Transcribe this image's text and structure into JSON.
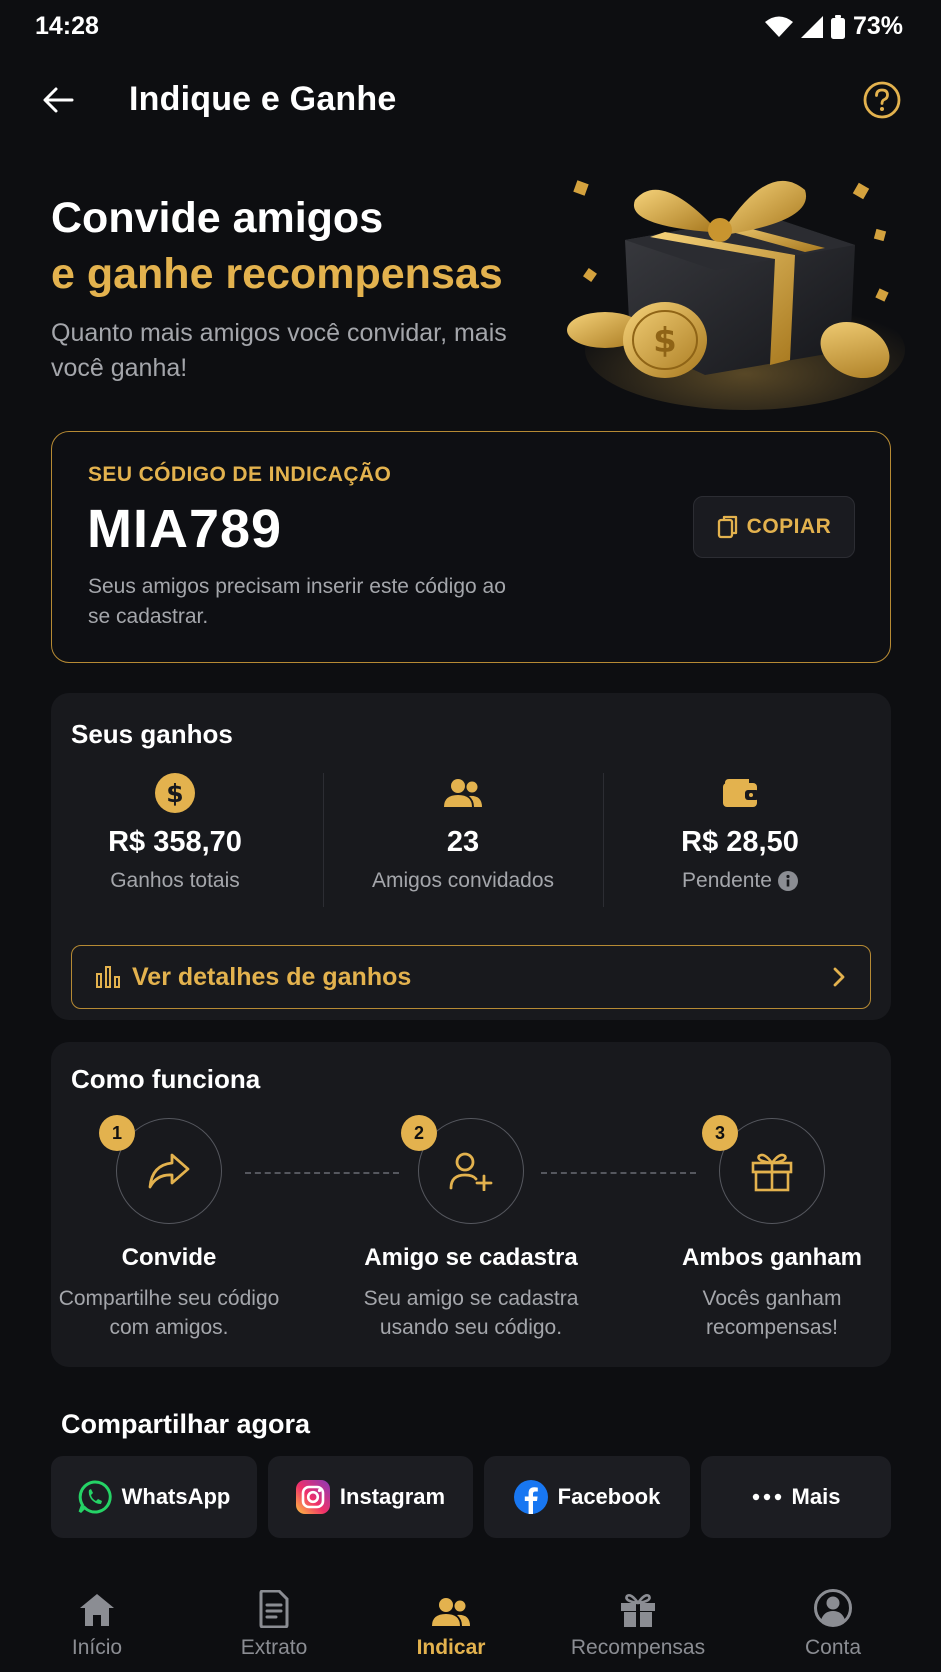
{
  "status": {
    "time": "14:28",
    "battery": "73%"
  },
  "header": {
    "title": "Indique e Ganhe"
  },
  "hero": {
    "title_line1": "Convide amigos",
    "title_line2": "e ganhe recompensas",
    "subtitle": "Quanto mais amigos você convidar, mais você ganha!"
  },
  "referral": {
    "label": "SEU CÓDIGO DE INDICAÇÃO",
    "code": "MIA789",
    "hint": "Seus amigos precisam inserir este código ao se cadastrar.",
    "copy_label": "COPIAR"
  },
  "earnings": {
    "title": "Seus ganhos",
    "stats": [
      {
        "icon": "dollar-coin-icon",
        "value": "R$ 358,70",
        "label": "Ganhos totais"
      },
      {
        "icon": "people-icon",
        "value": "23",
        "label": "Amigos convidados"
      },
      {
        "icon": "wallet-icon",
        "value": "R$ 28,50",
        "label": "Pendente"
      }
    ],
    "details_label": "Ver detalhes de ganhos"
  },
  "how": {
    "title": "Como funciona",
    "steps": [
      {
        "num": "1",
        "icon": "share-arrow-icon",
        "title": "Convide",
        "desc": "Compartilhe seu código com amigos."
      },
      {
        "num": "2",
        "icon": "add-user-icon",
        "title": "Amigo se cadastra",
        "desc": "Seu amigo se cadastra usando seu código."
      },
      {
        "num": "3",
        "icon": "gift-icon",
        "title": "Ambos ganham",
        "desc": "Vocês ganham recompensas!"
      }
    ]
  },
  "share": {
    "title": "Compartilhar agora",
    "buttons": [
      {
        "icon": "whatsapp-icon",
        "label": "WhatsApp"
      },
      {
        "icon": "instagram-icon",
        "label": "Instagram"
      },
      {
        "icon": "facebook-icon",
        "label": "Facebook"
      },
      {
        "icon": "more-dots-icon",
        "label": "Mais"
      }
    ]
  },
  "nav": {
    "items": [
      {
        "icon": "home-icon",
        "label": "Início"
      },
      {
        "icon": "statement-icon",
        "label": "Extrato"
      },
      {
        "icon": "people-icon",
        "label": "Indicar"
      },
      {
        "icon": "gift-icon",
        "label": "Recompensas"
      },
      {
        "icon": "account-icon",
        "label": "Conta"
      }
    ],
    "active": "Indicar"
  },
  "colors": {
    "accent": "#e3b24e",
    "background": "#0d0e11",
    "card": "#18191d",
    "muted": "#a4a6ab"
  }
}
